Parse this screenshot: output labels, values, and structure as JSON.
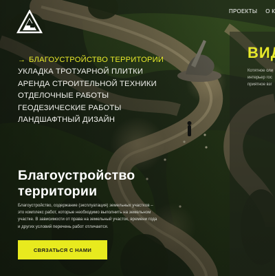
{
  "colors": {
    "accent": "#e8ea2a",
    "text": "#ffffff",
    "panel": "#1e221a"
  },
  "logo": {
    "icon": "triangle-logo-icon"
  },
  "topnav": {
    "items": [
      {
        "label": "ПРОЕКТЫ"
      },
      {
        "label": "О К"
      }
    ]
  },
  "services": {
    "items": [
      {
        "label": "БЛАГОУСТРОЙСТВО ТЕРРИТОРИИ",
        "active": true,
        "icon": "arrow-right-icon"
      },
      {
        "label": "УКЛАДКА ТРОТУАРНОЙ ПЛИТКИ"
      },
      {
        "label": "АРЕНДА СТРОИТЕЛЬНОЙ ТЕХНИКИ"
      },
      {
        "label": "ОТДЕЛОЧНЫЕ РАБОТЫ"
      },
      {
        "label": "ГЕОДЕЗИЧЕСКИЕ РАБОТЫ"
      },
      {
        "label": "ЛАНДШАФТНЫЙ ДИЗАЙН"
      }
    ]
  },
  "hero": {
    "title_line1": "Благоустройство",
    "title_line2": "территории",
    "text_line1": "Благоустройство, содержание (эксплуатация) земельных участков –",
    "text_line2": "это комплекс работ, которые необходимо выполнить на земельном",
    "text_line3": "участке. В зависимости от права на земельный участок, времени года",
    "text_line4": "и других условий перечень работ отличается.",
    "cta_label": "СВЯЗАТЬСЯ С НАМИ"
  },
  "side_panel": {
    "heading": "ВИД",
    "text_line1": "Котятное оли",
    "text_line2": "интерьер гос",
    "text_line3": "приятное взг"
  }
}
